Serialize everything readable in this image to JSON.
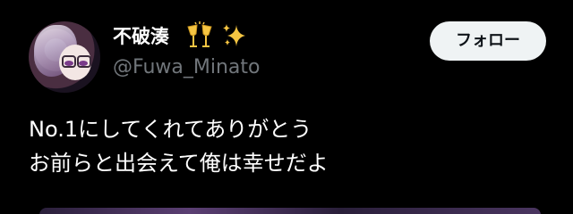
{
  "user": {
    "display_name": "不破湊",
    "handle": "@Fuwa_Minato",
    "name_emojis": [
      "clinking-glasses-emoji",
      "sparkles-emoji"
    ]
  },
  "follow_button": {
    "label": "フォロー"
  },
  "post": {
    "lines": [
      "No.1にしてくれてありがとう",
      "お前らと出会えて俺は幸せだよ"
    ]
  },
  "colors": {
    "background": "#000000",
    "text_primary": "#ffffff",
    "text_secondary": "#71767b",
    "button_bg": "#eff3f4",
    "button_text": "#0f1419",
    "emoji_gold": "#f5c542"
  }
}
